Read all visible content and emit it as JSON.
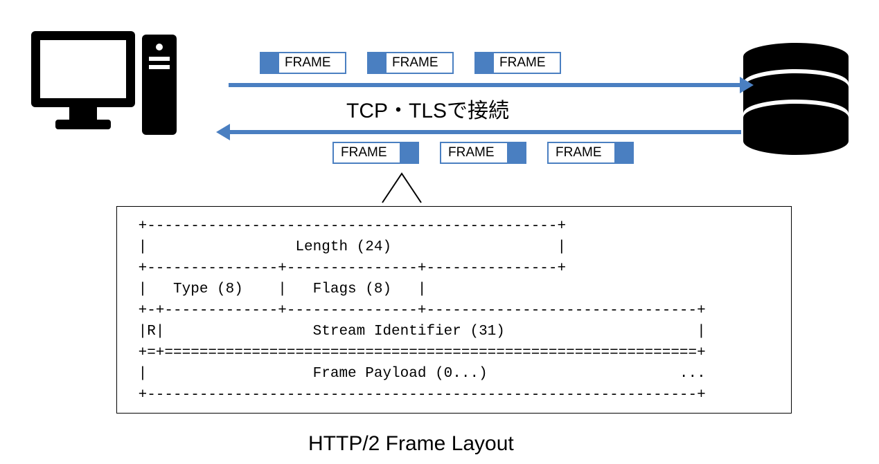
{
  "connection_label": "TCP・TLSで接続",
  "frame_label": "FRAME",
  "layout_title": "HTTP/2 Frame Layout",
  "ascii": {
    "l1": " +-----------------------------------------------+",
    "l2": " |                 Length (24)                   |",
    "l3": " +---------------+---------------+---------------+",
    "l4": " |   Type (8)    |   Flags (8)   |",
    "l5": " +-+-------------+---------------+-------------------------------+",
    "l6": " |R|                 Stream Identifier (31)                      |",
    "l7": " +=+=============================================================+",
    "l8": " |                   Frame Payload (0...)                      ...",
    "l9": " +---------------------------------------------------------------+"
  }
}
